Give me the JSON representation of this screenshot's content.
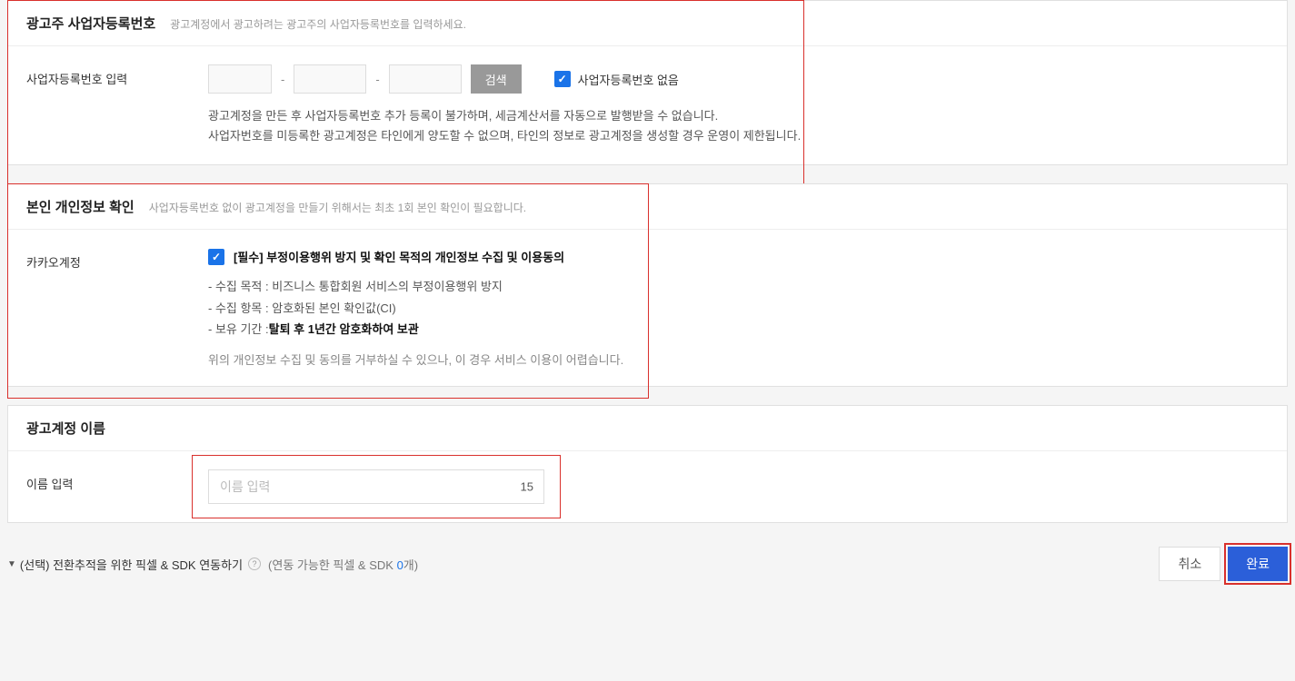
{
  "section1": {
    "title": "광고주 사업자등록번호",
    "subtitle": "광고계정에서 광고하려는 광고주의 사업자등록번호를 입력하세요.",
    "label": "사업자등록번호 입력",
    "dash": "-",
    "search_btn": "검색",
    "no_biz_label": "사업자등록번호 없음",
    "helper1": "광고계정을 만든 후 사업자등록번호 추가 등록이 불가하며, 세금계산서를 자동으로 발행받을 수 없습니다.",
    "helper2": "사업자번호를 미등록한 광고계정은 타인에게 양도할 수 없으며, 타인의 정보로 광고계정을 생성할 경우 운영이 제한됩니다."
  },
  "section2": {
    "title": "본인 개인정보 확인",
    "subtitle": "사업자등록번호 없이 광고계정을 만들기 위해서는 최초 1회 본인 확인이 필요합니다.",
    "label": "카카오계정",
    "consent_title": "[필수] 부정이용행위 방지 및 확인 목적의 개인정보 수집 및 이용동의",
    "li1": "- 수집 목적 : 비즈니스 통합회원 서비스의 부정이용행위 방지",
    "li2": "- 수집 항목 : 암호화된 본인 확인값(CI)",
    "li3_prefix": "- 보유 기간 :",
    "li3_bold": "탈퇴 후 1년간 암호화하여 보관",
    "consent_footer": "위의 개인정보 수집 및 동의를 거부하실 수 있으나, 이 경우 서비스 이용이 어렵습니다."
  },
  "section3": {
    "title": "광고계정 이름",
    "label": "이름 입력",
    "placeholder": "이름 입력",
    "counter": "15"
  },
  "bottom": {
    "expand_text": "(선택) 전환추적을 위한 픽셀 & SDK 연동하기",
    "pixel_prefix": "(연동 가능한 픽셀 & SDK ",
    "pixel_count": "0",
    "pixel_suffix": "개)",
    "cancel": "취소",
    "submit": "완료"
  }
}
